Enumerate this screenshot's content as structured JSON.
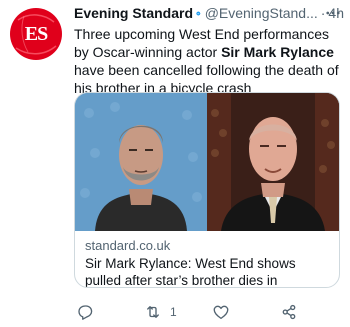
{
  "account": {
    "display_name": "Evening Standard",
    "handle": "@EveningStand...",
    "separator": "·",
    "time": "4h",
    "avatar_text": "ES",
    "brand_color": "#e0001b",
    "verified_color": "#1d9bf0"
  },
  "tweet": {
    "text_before": "Three upcoming West End performances by Oscar-winning actor ",
    "text_bold": "Sir Mark Rylance",
    "text_after": " have been cancelled following the death of his brother in a bicycle crash"
  },
  "card": {
    "domain": "standard.co.uk",
    "title": "Sir Mark Rylance: West End shows pulled after star’s brother dies in motorbike crash"
  },
  "actions": {
    "reply_icon": "comment-icon",
    "retweet_icon": "retweet-icon",
    "retweet_count": "1",
    "like_icon": "heart-icon",
    "share_icon": "share-icon"
  }
}
